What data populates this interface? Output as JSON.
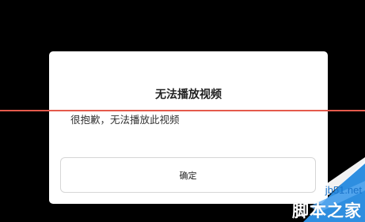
{
  "dialog": {
    "title": "无法播放视频",
    "message": "很抱歉，无法播放此视频",
    "confirm_label": "确定"
  },
  "watermark": {
    "site": "jb51.net",
    "brand": "脚本之家"
  },
  "colors": {
    "background": "#000000",
    "dialog_background": "#ffffff",
    "red_line": "#e45a4c",
    "watermark_blue": "#2e8ee0"
  }
}
